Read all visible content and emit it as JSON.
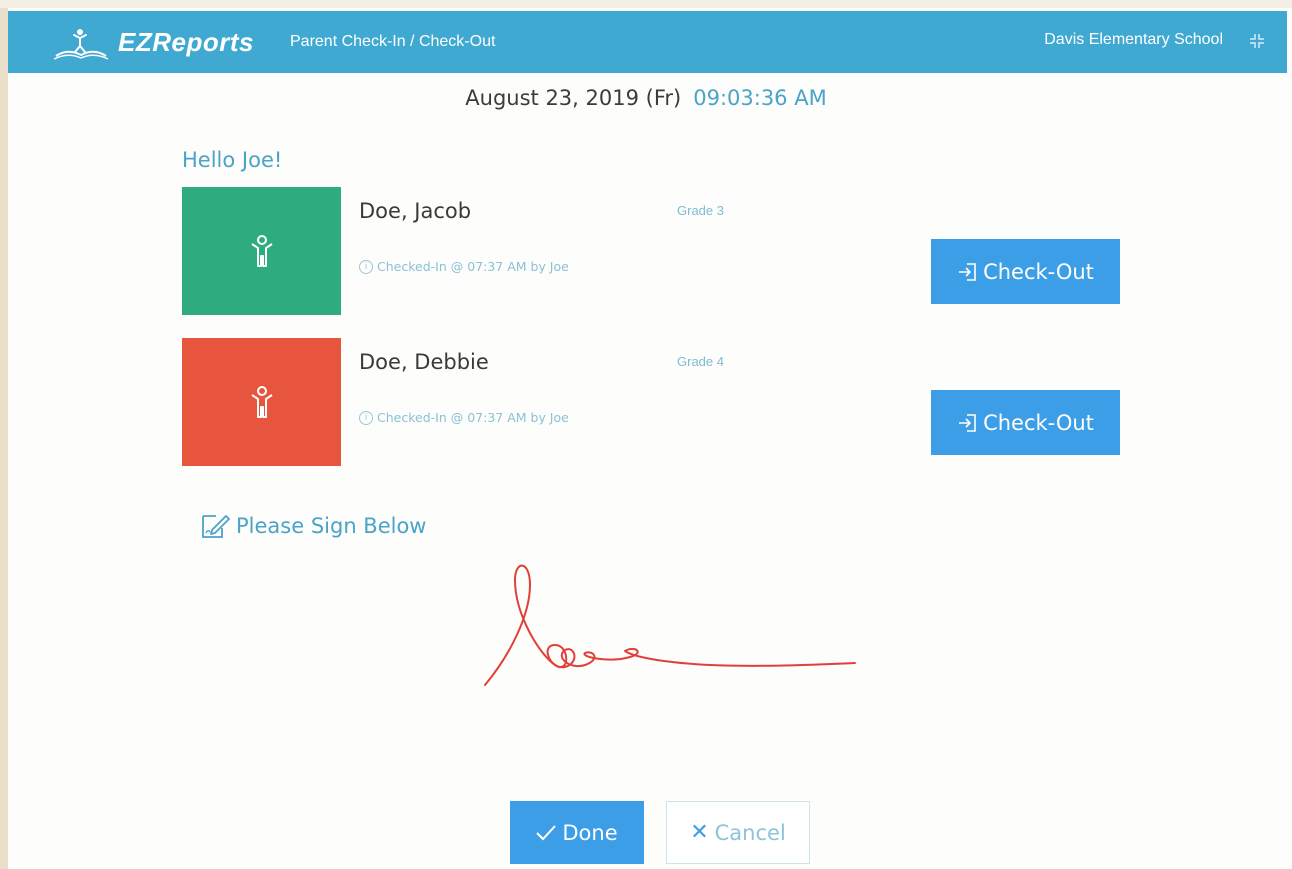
{
  "header": {
    "brand": "EZReports",
    "subtitle": "Parent Check-In / Check-Out",
    "school": "Davis Elementary School",
    "background": "#3fa9d2"
  },
  "datetime": {
    "date": "August 23, 2019 (Fr)",
    "time": "09:03:36 AM"
  },
  "greeting": "Hello Joe!",
  "students": [
    {
      "name": "Doe, Jacob",
      "grade": "Grade 3",
      "status": "Checked-In @ 07:37 AM by Joe",
      "avatar_color": "#2eac7e",
      "action_label": "Check-Out"
    },
    {
      "name": "Doe, Debbie",
      "grade": "Grade 4",
      "status": "Checked-In @ 07:37 AM by Joe",
      "avatar_color": "#e8553f",
      "action_label": "Check-Out"
    }
  ],
  "signature": {
    "label": "Please Sign Below",
    "ink_color": "#e0403a"
  },
  "actions": {
    "done_label": "Done",
    "cancel_label": "Cancel"
  },
  "icons": {
    "logo": "person-on-book-logo",
    "fullscreen": "compress-icon",
    "avatar": "child-icon",
    "checkout": "sign-in-icon",
    "sign": "pen-to-square-icon",
    "done": "check-icon",
    "cancel": "x-icon"
  }
}
